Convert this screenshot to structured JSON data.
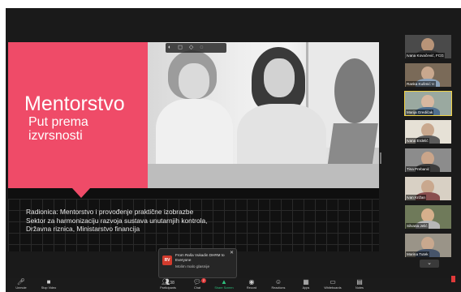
{
  "slide": {
    "title": "Mentorstvo",
    "subtitle": "Put prema izvrsnosti",
    "lines": [
      "Radionica: Mentorstvo i provođenje praktične izobrazbe",
      "Sektor za harmonizaciju razvoja sustava unutarnjih kontrola,",
      "Državna riznica, Ministarstvo financija"
    ],
    "overlay_toolbar": "◐ ◻ ◇ ◌"
  },
  "participants": [
    {
      "name": "Ivana Kovačević, FCG"
    },
    {
      "name": "Ranka Kušmić V."
    },
    {
      "name": "Marija Gredičak"
    },
    {
      "name": "Ivana Erdelić"
    },
    {
      "name": "Tina Prebanić"
    },
    {
      "name": "Ivan Križan"
    },
    {
      "name": "Silvana Jelić"
    },
    {
      "name": "Marina Tutek"
    }
  ],
  "more_participants": "⌄",
  "chat": {
    "avatar": "RV",
    "from": "From Raša Vukadin DHRM to Everyone",
    "message": "Molim malo glasnije"
  },
  "toolbar": {
    "unmute": "Unmute",
    "stop_video": "Stop Video",
    "participants": "Participants",
    "participants_count": "38",
    "chat": "Chat",
    "chat_badge": "2",
    "share_screen": "Share Screen",
    "record": "Record",
    "reactions": "Reactions",
    "apps": "Apps",
    "whiteboards": "Whiteboards",
    "notes": "Notes"
  },
  "colors": {
    "slide_accent": "#ef4b68",
    "share": "#2ec27e",
    "alert": "#e03a3a"
  }
}
